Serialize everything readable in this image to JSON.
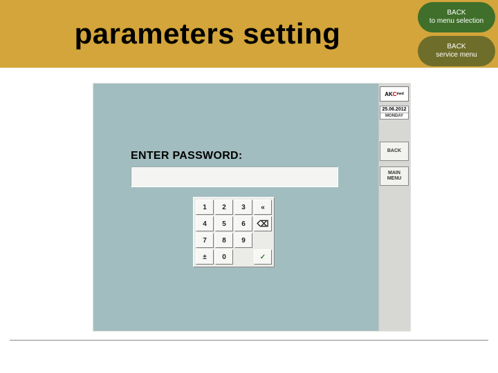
{
  "header": {
    "title": "parameters setting"
  },
  "nav": {
    "menu_selection": {
      "line1": "BACK",
      "line2": "to  menu  selection"
    },
    "service_menu": {
      "line1": "BACK",
      "line2": "service menu"
    }
  },
  "device": {
    "logo": {
      "part1": "AK",
      "part2": "C",
      "sup": "med"
    },
    "date": {
      "value": "25.06.2012",
      "day": "MONDAY"
    },
    "side_buttons": {
      "back": "BACK",
      "main": "MAIN MENU"
    },
    "prompt": "ENTER PASSWORD:",
    "password_value": "",
    "keypad": {
      "r1": [
        "1",
        "2",
        "3",
        "«"
      ],
      "r2": [
        "4",
        "5",
        "6",
        "⌫"
      ],
      "r3": [
        "7",
        "8",
        "9"
      ],
      "r4": [
        "±",
        "0",
        "✓"
      ]
    }
  }
}
